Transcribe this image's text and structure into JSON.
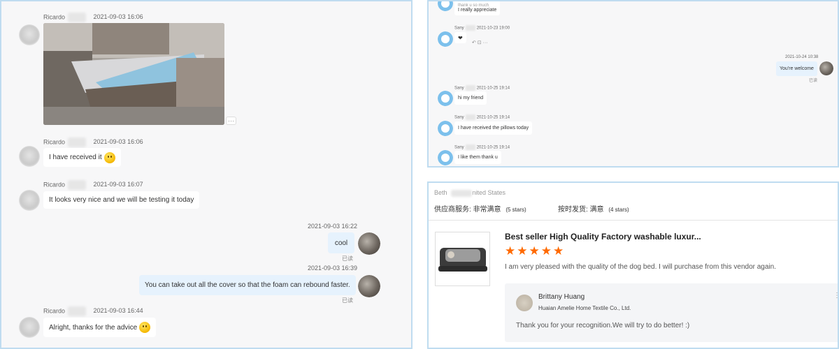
{
  "left_chat": {
    "messages": [
      {
        "sender": "Ricardo",
        "time": "2021-09-03 16:06"
      },
      {
        "sender": "Ricardo",
        "time": "2021-09-03 16:06",
        "text": "I have received it"
      },
      {
        "sender": "Ricardo",
        "time": "2021-09-03 16:07",
        "text": "It looks very nice and we will be testing it today"
      },
      {
        "time": "2021-09-03 16:22",
        "text": "cool",
        "status": "已读"
      },
      {
        "time": "2021-09-03 16:39",
        "text": "You can take out all the cover so that the foam can rebound faster.",
        "status": "已读"
      },
      {
        "sender": "Ricardo",
        "time": "2021-09-03 16:44",
        "text": "Alright, thanks for the advice"
      }
    ],
    "more_label": "···"
  },
  "right_chat": {
    "top_partial": "thank u so much",
    "top_text": "I really appreciate",
    "messages": [
      {
        "sender": "Sany",
        "time": "2021-10-23 19:00",
        "text": "❤"
      },
      {
        "time": "2021-10-24 10:38",
        "text": "You're welcome",
        "status": "已读"
      },
      {
        "sender": "Sany",
        "time": "2021-10-25 19:14",
        "text": "hi my friend"
      },
      {
        "sender": "Sany",
        "time": "2021-10-25 19:14",
        "text": "I have received the pillows today"
      },
      {
        "sender": "Sany",
        "time": "2021-10-25 19:14",
        "text": "I like them thank u"
      }
    ],
    "reaction_icons": "↶ ⊡ ···"
  },
  "review": {
    "reviewer_prefix": "Beth",
    "reviewer_suffix": "nited States",
    "supplier_service_label": "供应商服务:",
    "supplier_service_value": "非常满意",
    "supplier_service_stars": "(5 stars)",
    "ontime_label": "按时发货:",
    "ontime_value": "满意",
    "ontime_stars": "(4 stars)",
    "product_title": "Best seller High Quality Factory washable luxur...",
    "rating": 5,
    "stars": "★★★★★",
    "comment": "I am very pleased with the quality of the dog bed.  I will purchase from this vendor again.",
    "reply": {
      "name": "Brittany Huang",
      "company": "Huaian Amelie Home Textile Co., Ltd.",
      "text": "Thank you for your recognition.We will try to do better! :)"
    }
  }
}
